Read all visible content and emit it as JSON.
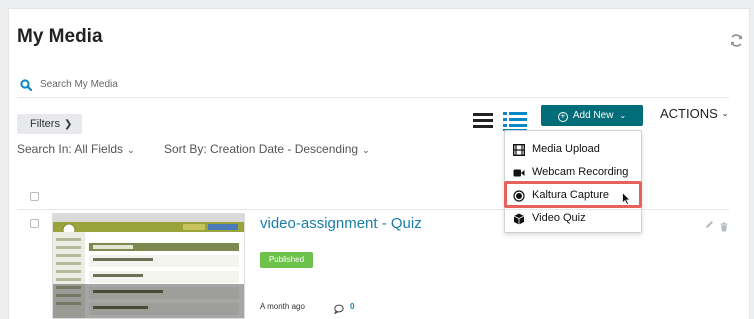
{
  "page": {
    "title": "My Media",
    "refresh_icon": "refresh-icon"
  },
  "search": {
    "placeholder": "Search My Media",
    "icon": "search-icon",
    "icon_color": "#0a87c4"
  },
  "filters": {
    "button_label": "Filters",
    "search_in": "Search In: All Fields",
    "sort_by": "Sort By: Creation Date - Descending"
  },
  "toolbar": {
    "add_new_label": "Add New",
    "actions_label": "ACTIONS",
    "add_new_color": "#006d78",
    "view_icon_color": "#0a87c4"
  },
  "add_menu": {
    "items": [
      {
        "label": "Media Upload",
        "icon": "film-icon"
      },
      {
        "label": "Webcam Recording",
        "icon": "video-camera-icon"
      },
      {
        "label": "Kaltura Capture",
        "icon": "record-icon"
      },
      {
        "label": "Video Quiz",
        "icon": "cube-icon"
      }
    ],
    "highlight_color": "#e8625d"
  },
  "entries": [
    {
      "title": "video-assignment - Quiz",
      "status": "Published",
      "status_color": "#6cc24a",
      "created": "A month ago",
      "comments": "0"
    }
  ]
}
